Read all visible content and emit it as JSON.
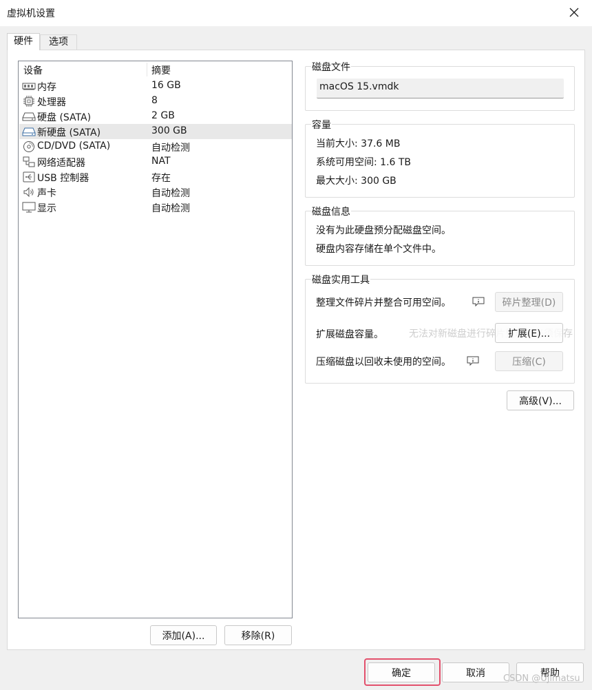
{
  "window": {
    "title": "虚拟机设置"
  },
  "tabs": [
    {
      "label": "硬件",
      "active": true
    },
    {
      "label": "选项",
      "active": false
    }
  ],
  "device_list": {
    "columns": [
      "设备",
      "摘要"
    ],
    "rows": [
      {
        "icon": "memory-icon",
        "name": "内存",
        "summary": "16 GB",
        "selected": false
      },
      {
        "icon": "processor-icon",
        "name": "处理器",
        "summary": "8",
        "selected": false
      },
      {
        "icon": "hard-disk-icon",
        "name": "硬盘 (SATA)",
        "summary": "2 GB",
        "selected": false
      },
      {
        "icon": "hard-disk-icon",
        "name": "新硬盘 (SATA)",
        "summary": "300 GB",
        "selected": true
      },
      {
        "icon": "cd-dvd-icon",
        "name": "CD/DVD (SATA)",
        "summary": "自动检测",
        "selected": false
      },
      {
        "icon": "network-adapter-icon",
        "name": "网络适配器",
        "summary": "NAT",
        "selected": false
      },
      {
        "icon": "usb-icon",
        "name": "USB 控制器",
        "summary": "存在",
        "selected": false
      },
      {
        "icon": "speaker-icon",
        "name": "声卡",
        "summary": "自动检测",
        "selected": false
      },
      {
        "icon": "monitor-icon",
        "name": "显示",
        "summary": "自动检测",
        "selected": false
      }
    ]
  },
  "list_buttons": {
    "add": "添加(A)...",
    "remove": "移除(R)"
  },
  "disk_file": {
    "label": "磁盘文件",
    "value": "macOS 15.vmdk"
  },
  "capacity": {
    "label": "容量",
    "current_size": "当前大小: 37.6 MB",
    "system_free": "系统可用空间: 1.6 TB",
    "max_size": "最大大小: 300 GB"
  },
  "disk_info": {
    "label": "磁盘信息",
    "line1": "没有为此硬盘预分配磁盘空间。",
    "line2": "硬盘内容存储在单个文件中。"
  },
  "disk_utilities": {
    "label": "磁盘实用工具",
    "defrag_text": "整理文件碎片并整合可用空间。",
    "defrag_button": "碎片整理(D)",
    "expand_text": "扩展磁盘容量。",
    "expand_button": "扩展(E)...",
    "compact_text": "压缩磁盘以回收未使用的空间。",
    "compact_button": "压缩(C)",
    "tooltip_text": "无法对新磁盘进行碎片整理，必须保存"
  },
  "advanced_button": "高级(V)...",
  "footer": {
    "ok": "确定",
    "cancel": "取消",
    "help": "帮助"
  },
  "watermark": "CSDN @Ujimatsu",
  "colors": {
    "highlight": "#e3506c",
    "selected_row": "#e8e8e8",
    "disabled_text": "#8a8a8a"
  }
}
